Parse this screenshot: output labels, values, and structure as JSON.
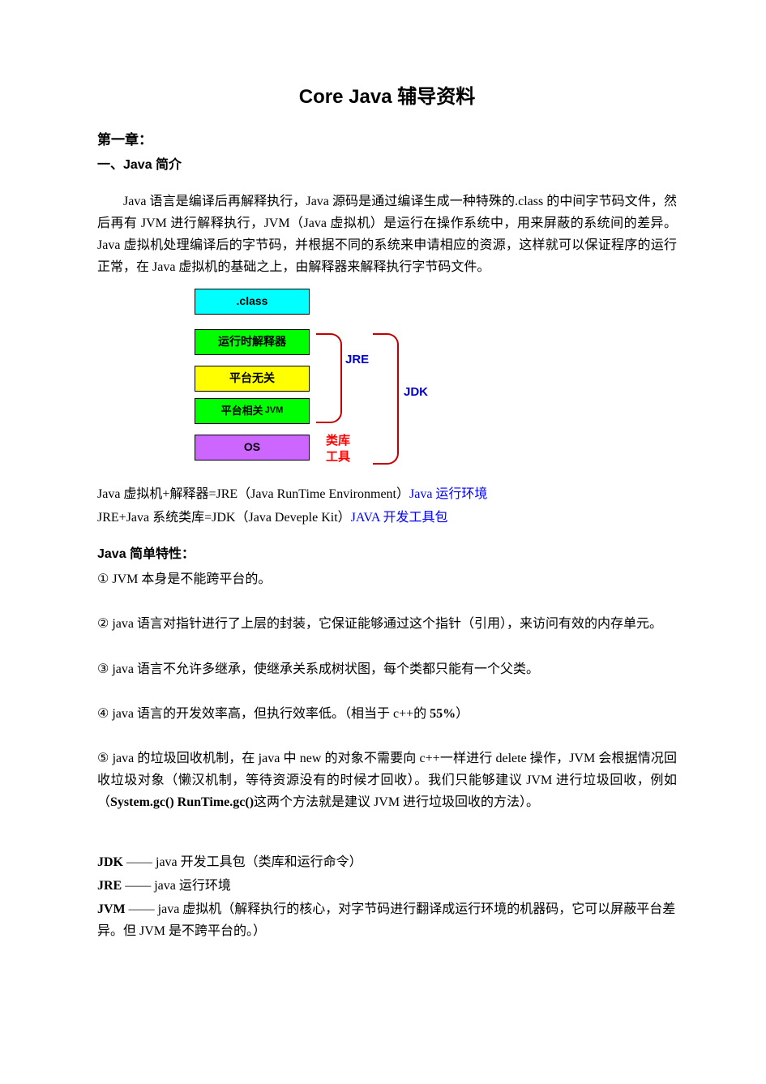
{
  "title": "Core Java 辅导资料",
  "chapter": "第一章：",
  "section": "一、Java 简介",
  "intro": "Java 语言是编译后再解释执行，Java 源码是通过编译生成一种特殊的.class 的中间字节码文件，然后再有 JVM 进行解释执行，JVM（Java 虚拟机）是运行在操作系统中，用来屏蔽的系统间的差异。Java 虚拟机处理编译后的字节码，并根据不同的系统来申请相应的资源，这样就可以保证程序的运行正常，在 Java 虚拟机的基础之上，由解释器来解释执行字节码文件。",
  "diagram": {
    "class": ".class",
    "interp": "运行时解释器",
    "pi": "平台无关",
    "jvm_a": "平台相关",
    "jvm_b": "JVM",
    "os": "OS",
    "jre": "JRE",
    "jdk": "JDK",
    "lib": "类库",
    "tool": "工具"
  },
  "line_jre_a": "Java 虚拟机+解释器=JRE（Java RunTime Environment）",
  "line_jre_b": "Java 运行环境",
  "line_jdk_a": "JRE+Java 系统类库=JDK（Java Deveple Kit）",
  "line_jdk_b": "JAVA 开发工具包",
  "features_title": "Java 简单特性：",
  "f1": "① JVM 本身是不能跨平台的。",
  "f2": "② java 语言对指针进行了上层的封装，它保证能够通过这个指针（引用），来访问有效的内存单元。",
  "f3": "③ java 语言不允许多继承，使继承关系成树状图，每个类都只能有一个父类。",
  "f4_a": "④ java 语言的开发效率高，但执行效率低。（相当于 c++的 ",
  "f4_b": "55%",
  "f4_c": "）",
  "f5_a": "⑤ java 的垃圾回收机制，在 java 中 new 的对象不需要向 c++一样进行 delete 操作，JVM 会根据情况回收垃圾对象（懒汉机制，等待资源没有的时候才回收）。我们只能够建议 JVM 进行垃圾回收，例如（",
  "f5_b": "System.gc()    RunTime.gc()",
  "f5_c": "这两个方法就是建议 JVM 进行垃圾回收的方法）。",
  "def_jdk_a": "JDK",
  "def_jdk_b": " —— java 开发工具包（类库和运行命令）",
  "def_jre_a": "JRE",
  "def_jre_b": " —— java 运行环境",
  "def_jvm_a": "JVM",
  "def_jvm_b": "  ——  java 虚拟机（解释执行的核心，对字节码进行翻译成运行环境的机器码，它可以屏蔽平台差异。但 JVM 是不跨平台的。）"
}
